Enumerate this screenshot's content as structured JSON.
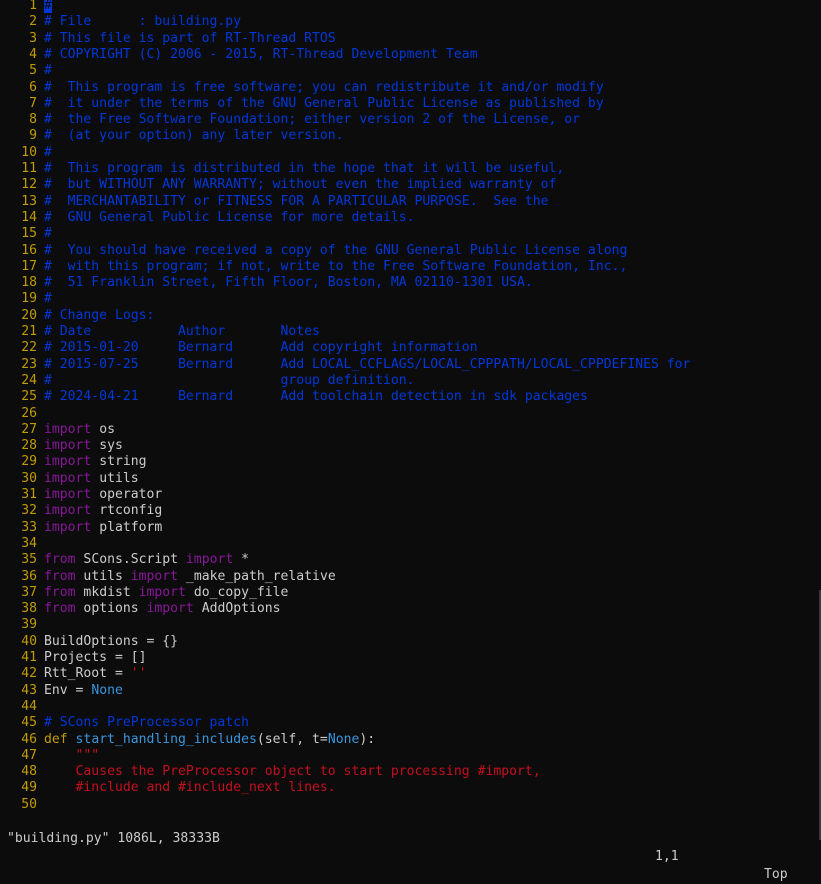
{
  "editor": {
    "lines": [
      {
        "n": "1",
        "segs": [
          {
            "c": "cursor",
            "t": "#"
          }
        ]
      },
      {
        "n": "2",
        "segs": [
          {
            "c": "cmt",
            "t": "# File      : building.py"
          }
        ]
      },
      {
        "n": "3",
        "segs": [
          {
            "c": "cmt",
            "t": "# This file is part of RT-Thread RTOS"
          }
        ]
      },
      {
        "n": "4",
        "segs": [
          {
            "c": "cmt",
            "t": "# COPYRIGHT (C) 2006 - 2015, RT-Thread Development Team"
          }
        ]
      },
      {
        "n": "5",
        "segs": [
          {
            "c": "cmt",
            "t": "#"
          }
        ]
      },
      {
        "n": "6",
        "segs": [
          {
            "c": "cmt",
            "t": "#  This program is free software; you can redistribute it and/or modify"
          }
        ]
      },
      {
        "n": "7",
        "segs": [
          {
            "c": "cmt",
            "t": "#  it under the terms of the GNU General Public License as published by"
          }
        ]
      },
      {
        "n": "8",
        "segs": [
          {
            "c": "cmt",
            "t": "#  the Free Software Foundation; either version 2 of the License, or"
          }
        ]
      },
      {
        "n": "9",
        "segs": [
          {
            "c": "cmt",
            "t": "#  (at your option) any later version."
          }
        ]
      },
      {
        "n": "10",
        "segs": [
          {
            "c": "cmt",
            "t": "#"
          }
        ]
      },
      {
        "n": "11",
        "segs": [
          {
            "c": "cmt",
            "t": "#  This program is distributed in the hope that it will be useful,"
          }
        ]
      },
      {
        "n": "12",
        "segs": [
          {
            "c": "cmt",
            "t": "#  but WITHOUT ANY WARRANTY; without even the implied warranty of"
          }
        ]
      },
      {
        "n": "13",
        "segs": [
          {
            "c": "cmt",
            "t": "#  MERCHANTABILITY or FITNESS FOR A PARTICULAR PURPOSE.  See the"
          }
        ]
      },
      {
        "n": "14",
        "segs": [
          {
            "c": "cmt",
            "t": "#  GNU General Public License for more details."
          }
        ]
      },
      {
        "n": "15",
        "segs": [
          {
            "c": "cmt",
            "t": "#"
          }
        ]
      },
      {
        "n": "16",
        "segs": [
          {
            "c": "cmt",
            "t": "#  You should have received a copy of the GNU General Public License along"
          }
        ]
      },
      {
        "n": "17",
        "segs": [
          {
            "c": "cmt",
            "t": "#  with this program; if not, write to the Free Software Foundation, Inc.,"
          }
        ]
      },
      {
        "n": "18",
        "segs": [
          {
            "c": "cmt",
            "t": "#  51 Franklin Street, Fifth Floor, Boston, MA 02110-1301 USA."
          }
        ]
      },
      {
        "n": "19",
        "segs": [
          {
            "c": "cmt",
            "t": "#"
          }
        ]
      },
      {
        "n": "20",
        "segs": [
          {
            "c": "cmt",
            "t": "# Change Logs:"
          }
        ]
      },
      {
        "n": "21",
        "segs": [
          {
            "c": "cmt",
            "t": "# Date           Author       Notes"
          }
        ]
      },
      {
        "n": "22",
        "segs": [
          {
            "c": "cmt",
            "t": "# 2015-01-20     Bernard      Add copyright information"
          }
        ]
      },
      {
        "n": "23",
        "segs": [
          {
            "c": "cmt",
            "t": "# 2015-07-25     Bernard      Add LOCAL_CCFLAGS/LOCAL_CPPPATH/LOCAL_CPPDEFINES for"
          }
        ]
      },
      {
        "n": "24",
        "segs": [
          {
            "c": "cmt",
            "t": "#                             group definition."
          }
        ]
      },
      {
        "n": "25",
        "segs": [
          {
            "c": "cmt",
            "t": "# 2024-04-21     Bernard      Add toolchain detection in sdk packages"
          }
        ]
      },
      {
        "n": "26",
        "segs": []
      },
      {
        "n": "27",
        "segs": [
          {
            "c": "kw",
            "t": "import"
          },
          {
            "c": "plain",
            "t": " os"
          }
        ]
      },
      {
        "n": "28",
        "segs": [
          {
            "c": "kw",
            "t": "import"
          },
          {
            "c": "plain",
            "t": " sys"
          }
        ]
      },
      {
        "n": "29",
        "segs": [
          {
            "c": "kw",
            "t": "import"
          },
          {
            "c": "plain",
            "t": " string"
          }
        ]
      },
      {
        "n": "30",
        "segs": [
          {
            "c": "kw",
            "t": "import"
          },
          {
            "c": "plain",
            "t": " utils"
          }
        ]
      },
      {
        "n": "31",
        "segs": [
          {
            "c": "kw",
            "t": "import"
          },
          {
            "c": "plain",
            "t": " operator"
          }
        ]
      },
      {
        "n": "32",
        "segs": [
          {
            "c": "kw",
            "t": "import"
          },
          {
            "c": "plain",
            "t": " rtconfig"
          }
        ]
      },
      {
        "n": "33",
        "segs": [
          {
            "c": "kw",
            "t": "import"
          },
          {
            "c": "plain",
            "t": " platform"
          }
        ]
      },
      {
        "n": "34",
        "segs": []
      },
      {
        "n": "35",
        "segs": [
          {
            "c": "kw",
            "t": "from"
          },
          {
            "c": "plain",
            "t": " SCons.Script "
          },
          {
            "c": "kw",
            "t": "import"
          },
          {
            "c": "plain",
            "t": " *"
          }
        ]
      },
      {
        "n": "36",
        "segs": [
          {
            "c": "kw",
            "t": "from"
          },
          {
            "c": "plain",
            "t": " utils "
          },
          {
            "c": "kw",
            "t": "import"
          },
          {
            "c": "plain",
            "t": " _make_path_relative"
          }
        ]
      },
      {
        "n": "37",
        "segs": [
          {
            "c": "kw",
            "t": "from"
          },
          {
            "c": "plain",
            "t": " mkdist "
          },
          {
            "c": "kw",
            "t": "import"
          },
          {
            "c": "plain",
            "t": " do_copy_file"
          }
        ]
      },
      {
        "n": "38",
        "segs": [
          {
            "c": "kw",
            "t": "from"
          },
          {
            "c": "plain",
            "t": " options "
          },
          {
            "c": "kw",
            "t": "import"
          },
          {
            "c": "plain",
            "t": " AddOptions"
          }
        ]
      },
      {
        "n": "39",
        "segs": []
      },
      {
        "n": "40",
        "segs": [
          {
            "c": "plain",
            "t": "BuildOptions = {}"
          }
        ]
      },
      {
        "n": "41",
        "segs": [
          {
            "c": "plain",
            "t": "Projects = []"
          }
        ]
      },
      {
        "n": "42",
        "segs": [
          {
            "c": "plain",
            "t": "Rtt_Root = "
          },
          {
            "c": "str",
            "t": "''"
          }
        ]
      },
      {
        "n": "43",
        "segs": [
          {
            "c": "plain",
            "t": "Env = "
          },
          {
            "c": "const",
            "t": "None"
          }
        ]
      },
      {
        "n": "44",
        "segs": []
      },
      {
        "n": "45",
        "segs": [
          {
            "c": "cmt",
            "t": "# SCons PreProcessor patch"
          }
        ]
      },
      {
        "n": "46",
        "segs": [
          {
            "c": "def",
            "t": "def"
          },
          {
            "c": "plain",
            "t": " "
          },
          {
            "c": "fn",
            "t": "start_handling_includes"
          },
          {
            "c": "plain",
            "t": "(self, t="
          },
          {
            "c": "const",
            "t": "None"
          },
          {
            "c": "plain",
            "t": "):"
          }
        ]
      },
      {
        "n": "47",
        "segs": [
          {
            "c": "str",
            "t": "    \"\"\""
          }
        ]
      },
      {
        "n": "48",
        "segs": [
          {
            "c": "str",
            "t": "    Causes the PreProcessor object to start processing #import,"
          }
        ]
      },
      {
        "n": "49",
        "segs": [
          {
            "c": "str",
            "t": "    #include and #include_next lines."
          }
        ]
      },
      {
        "n": "50",
        "segs": []
      }
    ]
  },
  "status": {
    "file": "\"building.py\" 1086L, 38333B",
    "position": "1,1",
    "scroll": "Top"
  },
  "colors": {
    "background": "#0c0c0c",
    "line_number": "#c19c00",
    "comment": "#0037da",
    "keyword": "#881798",
    "function": "#3a96dd",
    "string": "#c50f1f",
    "text": "#cccccc"
  }
}
